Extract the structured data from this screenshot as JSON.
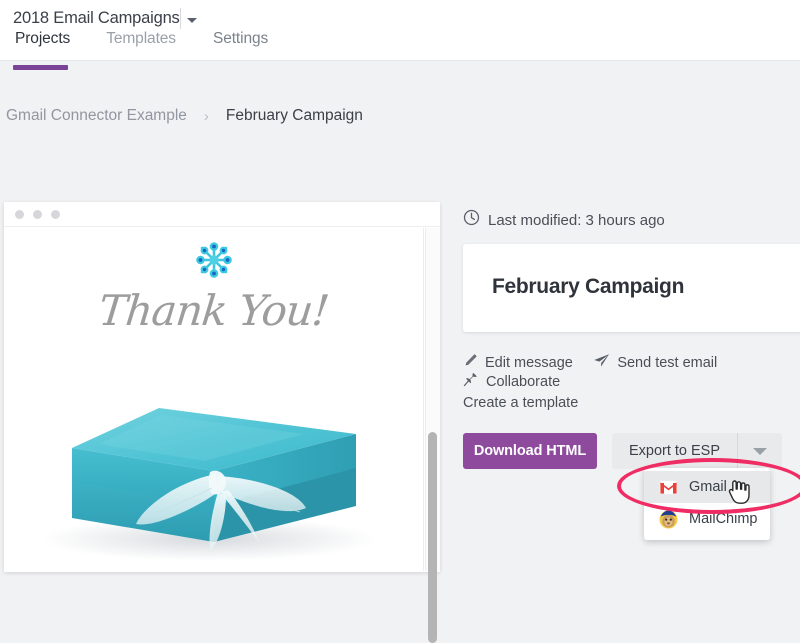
{
  "header": {
    "project_title": "2018 Email Campaigns",
    "project_dropdown_icon": "chevron-down-icon",
    "tabs": [
      {
        "label": "Projects",
        "active": true
      },
      {
        "label": "Templates",
        "active": false
      },
      {
        "label": "Settings",
        "active": false
      }
    ]
  },
  "breadcrumb": {
    "parent": "Gmail Connector Example",
    "separator": "›",
    "current": "February Campaign"
  },
  "preview": {
    "window_dots": 3,
    "email": {
      "headline": "Thank You!",
      "ornament_icon": "floral-ornament-icon",
      "hero_image": "teal-gift-box-with-white-ribbon"
    }
  },
  "details": {
    "clock_icon": "clock-icon",
    "last_modified": "Last modified: 3 hours ago",
    "campaign_name": "February Campaign",
    "actions": [
      {
        "label": "Edit message",
        "icon": "pencil-icon"
      },
      {
        "label": "Send test email",
        "icon": "paper-plane-icon"
      },
      {
        "label": "Collaborate",
        "icon": "pin-icon"
      }
    ],
    "create_template_label": "Create a template"
  },
  "buttons": {
    "download_html": "Download HTML",
    "export_to_esp": "Export to ESP",
    "export_caret_icon": "caret-down-icon"
  },
  "esp_menu": {
    "items": [
      {
        "label": "Gmail",
        "icon": "gmail-icon",
        "hovered": true
      },
      {
        "label": "MailChimp",
        "icon": "mailchimp-icon",
        "hovered": false
      }
    ]
  },
  "annotation": {
    "shape": "ellipse-highlight",
    "target": "Gmail"
  },
  "colors": {
    "accent_purple": "#8e4b9e",
    "tab_indicator": "#7b4397",
    "page_background": "#f1f2f4",
    "annotation_pink": "#ef2c63",
    "gmail_red": "#e8413a",
    "email_teal": "#5ec8d8"
  }
}
